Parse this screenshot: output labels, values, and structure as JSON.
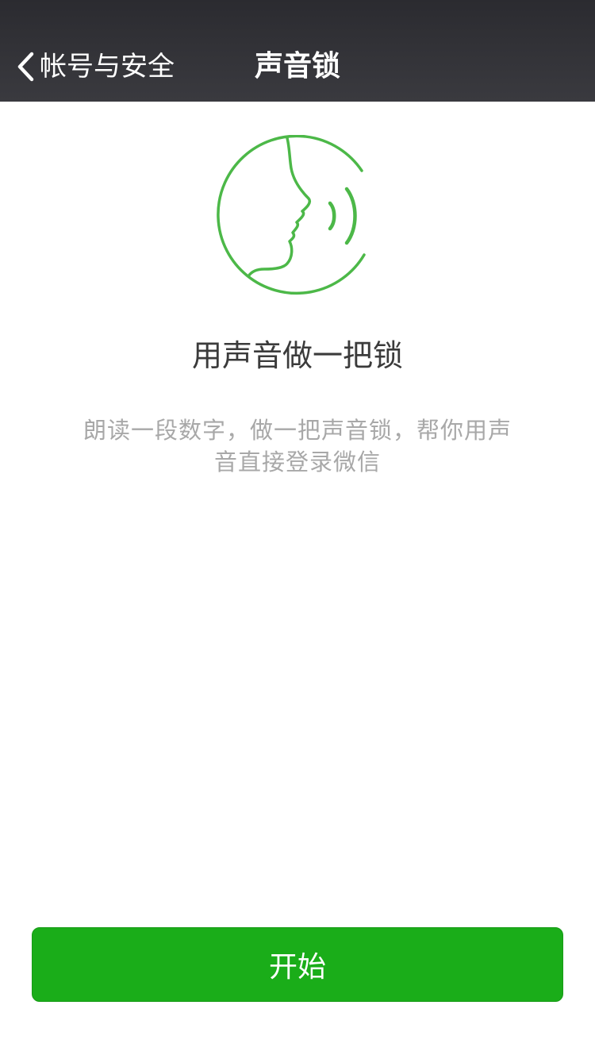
{
  "nav": {
    "back_label": "帐号与安全",
    "title": "声音锁"
  },
  "main": {
    "icon": "voice-lock-face-icon",
    "headline": "用声音做一把锁",
    "description": "朗读一段数字，做一把声音锁，帮你用声音直接登录微信"
  },
  "actions": {
    "start_label": "开始"
  },
  "colors": {
    "accent": "#1aad19",
    "icon_green": "#4cb848",
    "navbar": "#333338"
  }
}
